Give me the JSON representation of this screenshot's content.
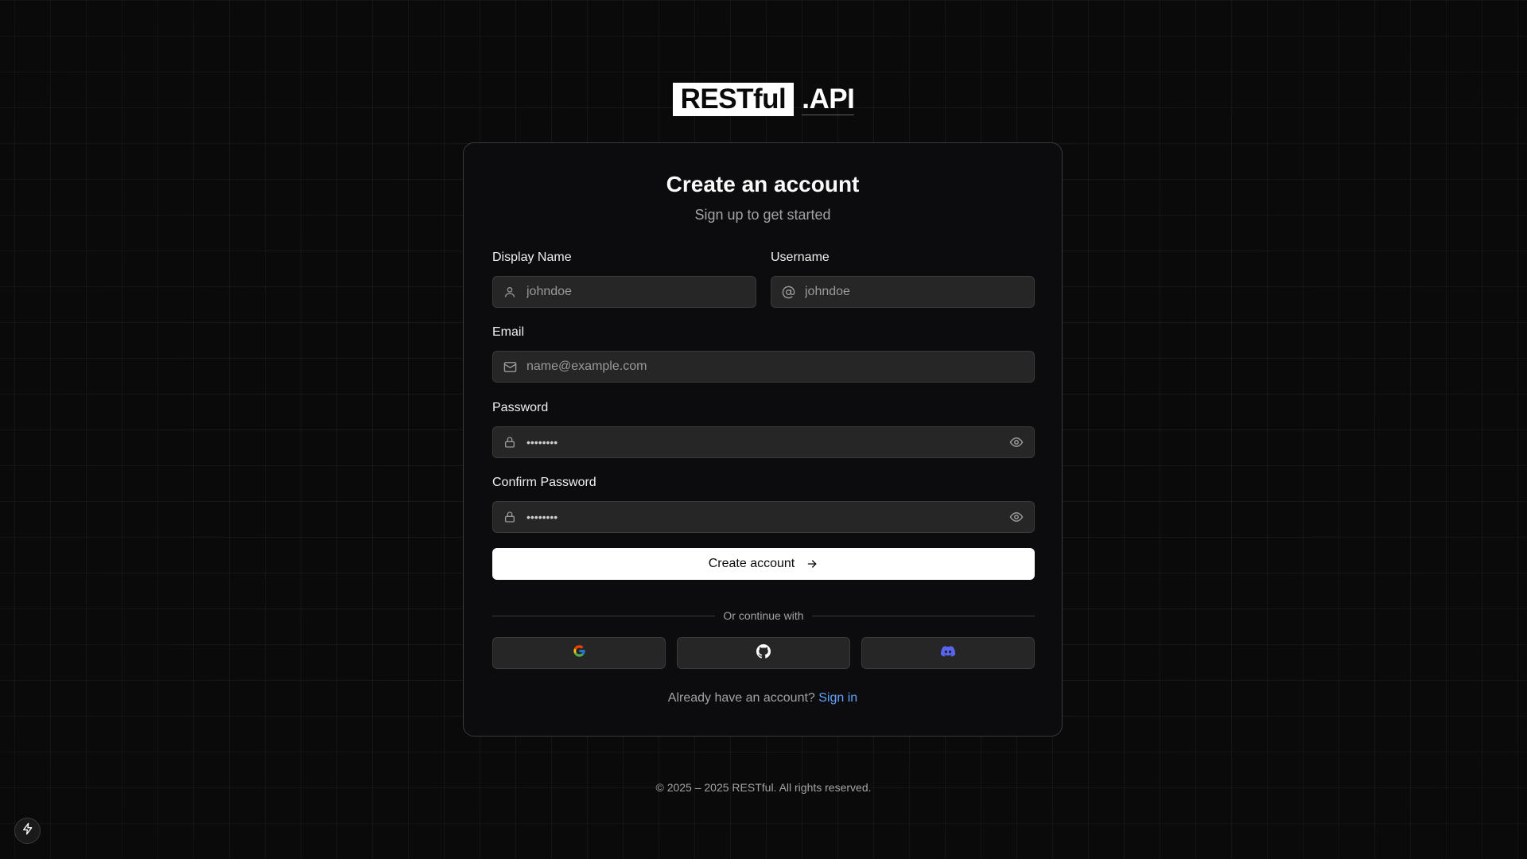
{
  "logo": {
    "boxed_text": "RESTful",
    "suffix_text": ".API"
  },
  "card": {
    "title": "Create an account",
    "subtitle": "Sign up to get started"
  },
  "form": {
    "display_name": {
      "label": "Display Name",
      "placeholder": "johndoe",
      "icon": "user-icon"
    },
    "username": {
      "label": "Username",
      "placeholder": "johndoe",
      "icon": "at-sign-icon"
    },
    "email": {
      "label": "Email",
      "placeholder": "name@example.com",
      "icon": "mail-icon"
    },
    "password": {
      "label": "Password",
      "value_masked": "••••••••",
      "icon": "lock-icon",
      "toggle_icon": "eye-icon"
    },
    "confirm_password": {
      "label": "Confirm Password",
      "value_masked": "••••••••",
      "icon": "lock-icon",
      "toggle_icon": "eye-icon"
    },
    "submit_label": "Create account",
    "submit_icon": "arrow-right-icon"
  },
  "divider": {
    "text": "Or continue with"
  },
  "social": [
    {
      "provider": "Google",
      "icon": "google-icon"
    },
    {
      "provider": "GitHub",
      "icon": "github-icon"
    },
    {
      "provider": "Discord",
      "icon": "discord-icon",
      "color": "#5865f2"
    }
  ],
  "signin": {
    "prompt": "Already have an account?",
    "link_label": "Sign in",
    "link_color": "#60a5fa"
  },
  "footer": {
    "copyright": "© 2025 – 2025 RESTful. All rights reserved."
  },
  "floating_button": {
    "icon": "lightning-bolt-icon"
  },
  "colors": {
    "background": "#0a0a0a",
    "card_background": "#0c0c0e",
    "input_background": "#262626",
    "border": "#3a3a3a",
    "primary_button": "#ffffff"
  }
}
